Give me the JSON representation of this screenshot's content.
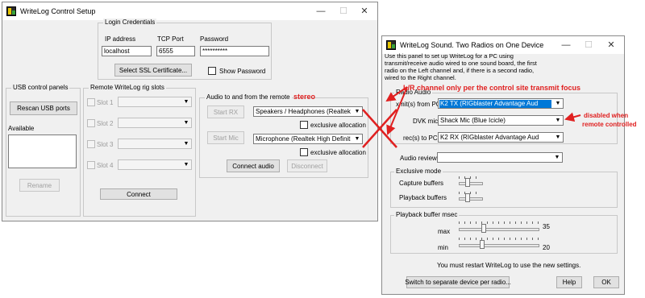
{
  "control_setup": {
    "title": "WriteLog Control Setup",
    "login": {
      "group_label": "Login Credentials",
      "ip_label": "IP address",
      "ip_value": "localhost",
      "port_label": "TCP Port",
      "port_value": "6555",
      "password_label": "Password",
      "password_value": "**********",
      "ssl_button": "Select SSL Certificate...",
      "show_password": "Show Password"
    },
    "usb": {
      "group_label": "USB control panels",
      "rescan_button": "Rescan USB ports",
      "available_label": "Available",
      "rename_button": "Rename"
    },
    "remote_slots": {
      "group_label": "Remote WriteLog rig slots",
      "slots": [
        "Slot 1",
        "Slot 2",
        "Slot 3",
        "Slot 4"
      ],
      "connect_button": "Connect"
    },
    "audio": {
      "group_label": "Audio to and from the remote",
      "start_rx": "Start RX",
      "rx_device": "Speakers / Headphones (Realtek High Definition Audio)",
      "exclusive1": "exclusive allocation",
      "start_mic": "Start Mic",
      "mic_device": "Microphone (Realtek High Definition Audio)",
      "exclusive2": "exclusive allocation",
      "connect_audio": "Connect audio",
      "disconnect": "Disconnect"
    }
  },
  "sound_setup": {
    "title": "WriteLog Sound. Two Radios on One Device",
    "description": "Use this panel to set up WriteLog for a PC using transmit/receive audio wired to one sound board, the first radio on the Left channel and, if there is a second radio, wired to the Right channel.",
    "radio_audio": {
      "group_label": "Radio Audio",
      "xmit_label": "xmit(s) from PC",
      "xmit_value": "K2 TX (RIGblaster Advantage Aud",
      "dvk_label": "DVK mic",
      "dvk_value": "Shack Mic (Blue Icicle)",
      "rec_label": "rec(s) to PC",
      "rec_value": "K2 RX (RIGblaster Advantage Aud"
    },
    "audio_review_label": "Audio review",
    "audio_review_value": "",
    "exclusive_mode": {
      "group_label": "Exclusive mode",
      "capture": "Capture buffers",
      "playback": "Playback buffers",
      "capture_level": 0.3,
      "playback_level": 0.3
    },
    "playback_buffer": {
      "group_label": "Playback buffer msec",
      "max_label": "max",
      "max_value": "35",
      "min_label": "min",
      "min_value": "20",
      "max_level": 0.3,
      "min_level": 0.27
    },
    "restart_note": "You must restart WriteLog to use the new settings.",
    "switch_button": "Switch to separate device per radio...",
    "help_button": "Help",
    "ok_button": "OK"
  },
  "annotations": {
    "stereo": "stereo",
    "lr_channel": "L/R channel only per the control site transmit focus",
    "disabled_when": "disabled when",
    "remote_controlled": "remote controlled"
  },
  "colors": {
    "annotation": "#e02020",
    "selection": "#0078d7"
  }
}
